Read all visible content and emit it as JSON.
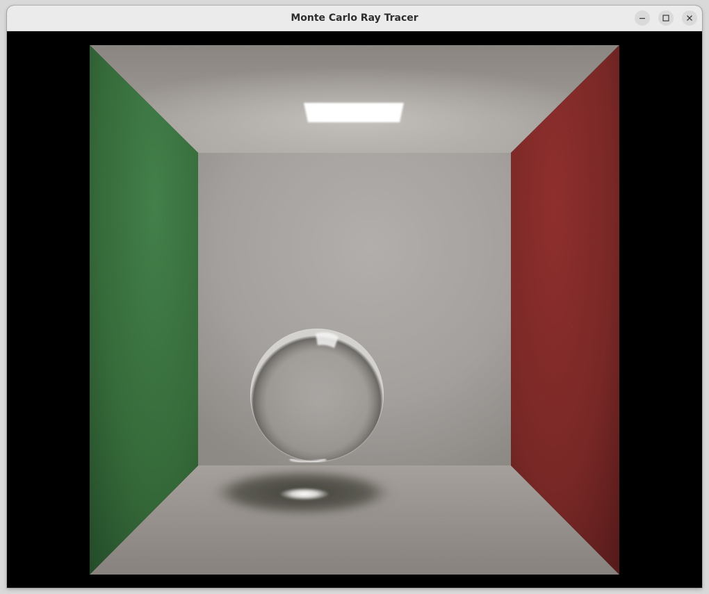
{
  "window": {
    "title": "Monte Carlo Ray Tracer",
    "controls": {
      "minimize": "minimize-icon",
      "maximize": "maximize-icon",
      "close": "close-icon"
    }
  },
  "scene": {
    "name": "cornell-box",
    "colors": {
      "left_wall": "#3b7040",
      "right_wall": "#7f2a29",
      "back_wall": "#a9a5a2",
      "ceiling": "#a29e99",
      "floor": "#9e9893",
      "light": "#ffffff",
      "background": "#000000"
    }
  }
}
